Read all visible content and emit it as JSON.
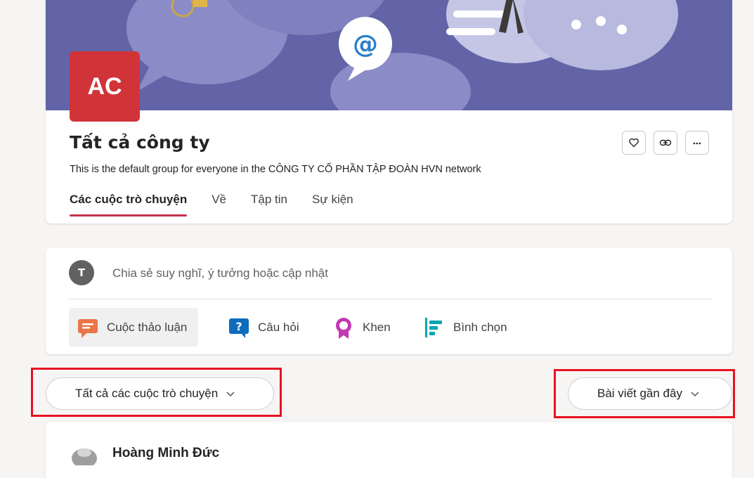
{
  "group": {
    "avatar_initials": "AC",
    "title": "Tất cả công ty",
    "description": "This is the default group for everyone in the CÔNG TY CỔ PHẦN TẬP ĐOÀN HVN network",
    "tabs": [
      {
        "label": "Các cuộc trò chuyện",
        "active": true
      },
      {
        "label": "Về",
        "active": false
      },
      {
        "label": "Tập tin",
        "active": false
      },
      {
        "label": "Sự kiện",
        "active": false
      }
    ],
    "actions": [
      "heart-icon",
      "link-icon",
      "more-icon"
    ]
  },
  "composer": {
    "user_initial": "T",
    "placeholder": "Chia sẻ suy nghĩ, ý tưởng hoặc cập nhật",
    "post_types": [
      {
        "label": "Cuộc thảo luận",
        "icon": "discussion-icon",
        "color": "#e97548"
      },
      {
        "label": "Câu hỏi",
        "icon": "question-icon",
        "color": "#0f6cbd"
      },
      {
        "label": "Khen",
        "icon": "praise-icon",
        "color": "#c239b3"
      },
      {
        "label": "Bình chọn",
        "icon": "poll-icon",
        "color": "#00a5af"
      }
    ]
  },
  "filters": {
    "conversations_filter": "Tất cả các cuộc trò chuyện",
    "sort_filter": "Bài viết gần đây"
  },
  "post": {
    "author": "Hoàng Minh Đức"
  },
  "colors": {
    "banner": "#6264a7",
    "avatar": "#d13438",
    "tab_underline": "#c4314b",
    "highlight": "#e81123"
  }
}
